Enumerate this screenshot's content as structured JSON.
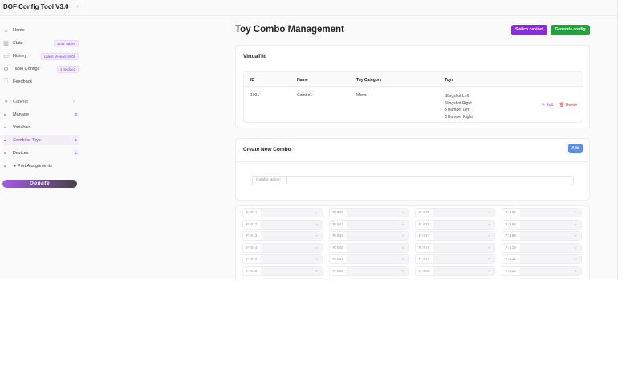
{
  "app": {
    "title": "DOF Config Tool V3.0"
  },
  "sidebar": {
    "items": [
      {
        "label": "Home",
        "icon": "home-icon",
        "badge": null
      },
      {
        "label": "Stats",
        "icon": "stats-icon",
        "badge": "1433 Tables"
      },
      {
        "label": "History",
        "icon": "history-icon",
        "badge": "Latest Version: 5006"
      },
      {
        "label": "Table Configs",
        "icon": "gear-icon",
        "badge": "1 modded"
      },
      {
        "label": "Feedback",
        "icon": "document-icon",
        "badge": null
      }
    ],
    "cabinet": {
      "label": "Cabinet",
      "icon": "share-icon",
      "items": [
        {
          "label": "Manage",
          "badge": "2"
        },
        {
          "label": "Variables",
          "badge": null
        },
        {
          "label": "Combine Toys",
          "badge": "1",
          "active": true
        },
        {
          "label": "Devices",
          "badge": "1"
        },
        {
          "label": "↳ Port Assignments",
          "badge": null
        }
      ]
    },
    "donate": "Donate"
  },
  "header": {
    "title": "Toy Combo Management",
    "switch_label": "Switch cabinet",
    "generate_label": "Generate config",
    "switch_color": "#8a2be2",
    "generate_color": "#22a23c"
  },
  "cabinet_card": {
    "title": "VirtuaTilt",
    "columns": [
      "ID",
      "Name",
      "Toy Category",
      "Toys"
    ],
    "rows": [
      {
        "id": "1001",
        "name": "Combo1",
        "category": "Mono",
        "toys": [
          "Slingshot Left",
          "Slingshot Right",
          "8 Bumper Left",
          "8 Bumper Right"
        ],
        "edit": "Edit",
        "delete": "Delete"
      }
    ]
  },
  "create": {
    "title": "Create New Combo",
    "add_label": "Add",
    "combo_name_label": "Combo Name:",
    "combo_name_value": ""
  },
  "ports": [
    [
      "P:011",
      "P:012",
      "P:013",
      "P:014",
      "P:015",
      "P:016"
    ],
    [
      "P:043",
      "P:044",
      "P:045",
      "P:046",
      "P:047",
      "P:048"
    ],
    [
      "P:075",
      "P:076",
      "P:077",
      "P:078",
      "P:079",
      "P:080"
    ],
    [
      "P:107",
      "P:108",
      "P:109",
      "P:110",
      "P:111",
      "P:112"
    ]
  ]
}
